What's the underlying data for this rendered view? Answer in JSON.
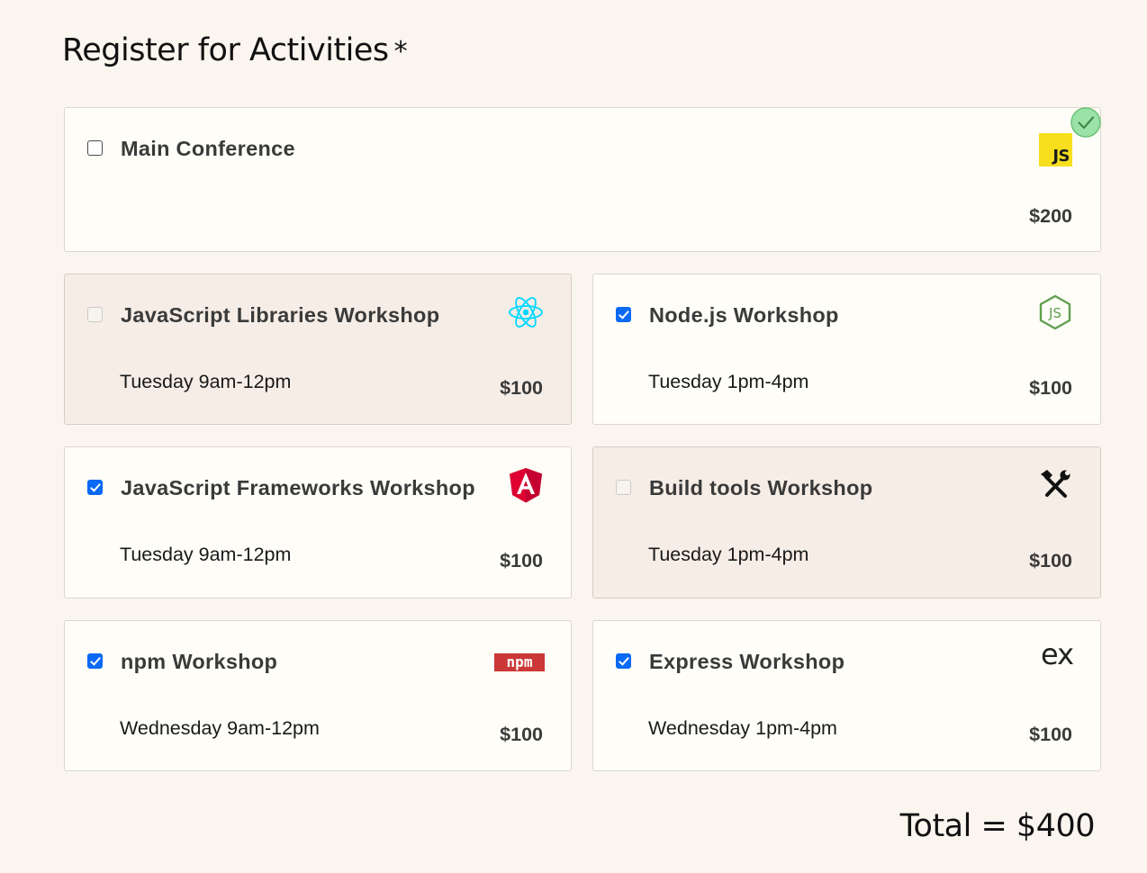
{
  "title": "Register for Activities",
  "required_marker": "*",
  "activities": [
    {
      "name": "Main Conference",
      "time": "",
      "price": "$200",
      "checked": false,
      "disabled": false,
      "logo": "js-logo",
      "valid": true
    },
    {
      "name": "JavaScript Libraries Workshop",
      "time": "Tuesday 9am-12pm",
      "price": "$100",
      "checked": false,
      "disabled": true,
      "logo": "react-logo"
    },
    {
      "name": "Node.js Workshop",
      "time": "Tuesday 1pm-4pm",
      "price": "$100",
      "checked": true,
      "disabled": false,
      "logo": "nodejs-logo"
    },
    {
      "name": "JavaScript Frameworks Workshop",
      "time": "Tuesday 9am-12pm",
      "price": "$100",
      "checked": true,
      "disabled": false,
      "logo": "angular-logo"
    },
    {
      "name": "Build tools Workshop",
      "time": "Tuesday 1pm-4pm",
      "price": "$100",
      "checked": false,
      "disabled": true,
      "logo": "hammer-wrench-icon"
    },
    {
      "name": "npm Workshop",
      "time": "Wednesday 9am-12pm",
      "price": "$100",
      "checked": true,
      "disabled": false,
      "logo": "npm-logo"
    },
    {
      "name": "Express Workshop",
      "time": "Wednesday 1pm-4pm",
      "price": "$100",
      "checked": true,
      "disabled": false,
      "logo": "express-logo"
    }
  ],
  "js_logo_text": "JS",
  "npm_logo_text": "npm",
  "express_logo_text": "ex",
  "total": "Total = $400",
  "colors": {
    "background": "#faf5ee",
    "card": "#fffdf8",
    "card_disabled": "#f5ede6",
    "checkbox_checked": "#0a69f5",
    "valid_badge": "#9be2a6",
    "js_yellow": "#f7df1e",
    "react_blue": "#00d8ff",
    "node_green": "#5fa04e",
    "angular_red": "#dd0031",
    "npm_red": "#cb3837"
  }
}
